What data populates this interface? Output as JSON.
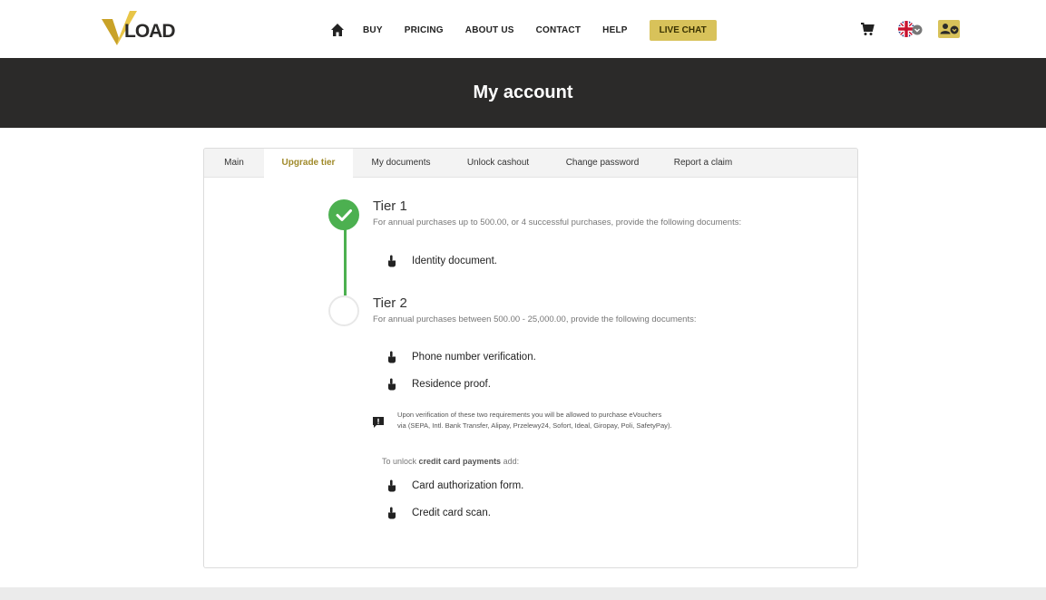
{
  "header": {
    "logo_text": "VLOAD",
    "nav": [
      "BUY",
      "PRICING",
      "ABOUT US",
      "CONTACT",
      "HELP"
    ],
    "live_chat": "LIVE CHAT",
    "icons": [
      "home-icon",
      "cart-icon",
      "uk-flag-icon",
      "account-icon"
    ]
  },
  "banner": {
    "title": "My account"
  },
  "tabs": [
    "Main",
    "Upgrade tier",
    "My documents",
    "Unlock cashout",
    "Change password",
    "Report a claim"
  ],
  "active_tab": "Upgrade tier",
  "tier1": {
    "title": "Tier 1",
    "description": "For annual purchases up to 500.00, or 4 successful purchases, provide the following documents:",
    "status": "completed",
    "requirements": [
      "Identity document."
    ]
  },
  "tier2": {
    "title": "Tier 2",
    "description": "For annual purchases between 500.00 - 25,000.00, provide the following documents:",
    "status": "pending",
    "requirements": [
      "Phone number verification.",
      "Residence proof."
    ],
    "note_line1": "Upon verification of these two requirements you will be allowed to purchase eVouchers",
    "note_line2": "via (SEPA, Intl. Bank Transfer, Alipay, Przelewy24, Sofort, Ideal, Giropay, Poli, SafetyPay).",
    "unlock_prefix": "To unlock ",
    "unlock_bold": "credit card payments",
    "unlock_suffix": " add:",
    "card_requirements": [
      "Card authorization form.",
      "Credit card scan."
    ]
  },
  "colors": {
    "accent": "#d8c25a",
    "success": "#4cb050",
    "banner": "#2b2a29"
  }
}
